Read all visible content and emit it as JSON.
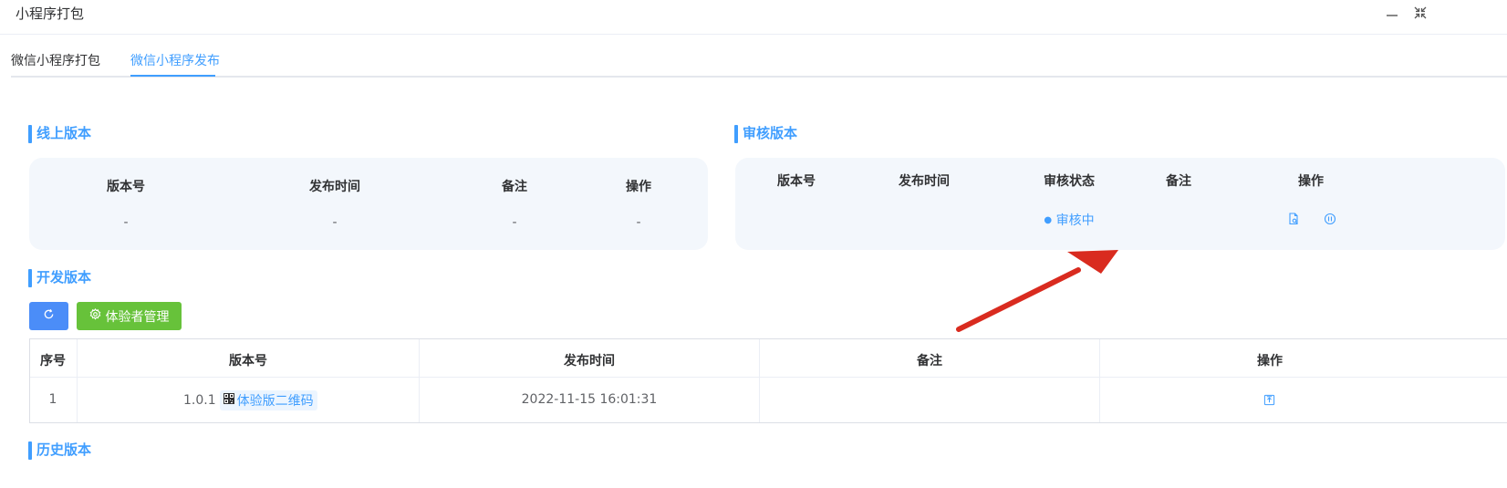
{
  "window": {
    "title": "小程序打包"
  },
  "tabs": [
    {
      "label": "微信小程序打包",
      "active": false
    },
    {
      "label": "微信小程序发布",
      "active": true
    }
  ],
  "online": {
    "title": "线上版本",
    "headers": [
      "版本号",
      "发布时间",
      "备注",
      "操作"
    ],
    "row": [
      "-",
      "-",
      "-",
      "-"
    ]
  },
  "review": {
    "title": "审核版本",
    "headers": [
      "版本号",
      "发布时间",
      "审核状态",
      "备注",
      "操作"
    ],
    "status": "审核中",
    "actions": [
      "view-detail-icon",
      "withdraw-icon"
    ]
  },
  "dev": {
    "title": "开发版本",
    "refresh_icon": "refresh-icon",
    "tester_button": "体验者管理",
    "headers": [
      "序号",
      "版本号",
      "发布时间",
      "备注",
      "操作"
    ],
    "rows": [
      {
        "index": "1",
        "version": "1.0.1",
        "qr_label": "体验版二维码",
        "time": "2022-11-15 16:01:31",
        "remark": "",
        "action_icon": "submit-review-icon"
      }
    ]
  },
  "history": {
    "title": "历史版本"
  },
  "colors": {
    "accent": "#409eff",
    "success": "#67c23a",
    "card_bg": "#f3f7fc",
    "annotation_arrow": "#d92b1f"
  }
}
